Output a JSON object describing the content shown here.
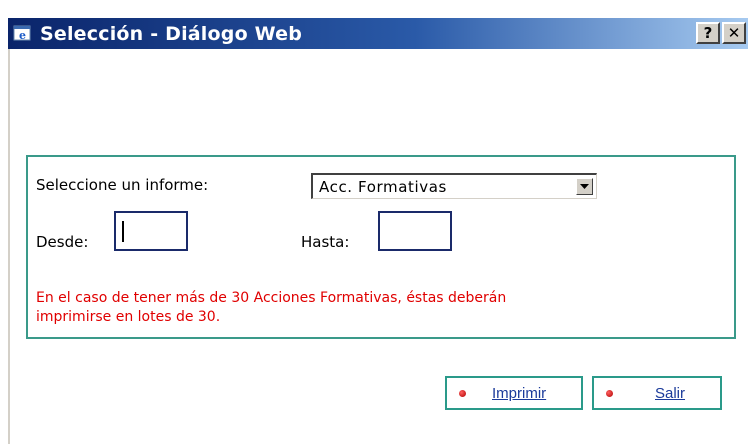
{
  "window": {
    "title": "Selección - Diálogo Web",
    "help_label": "?",
    "close_label": "✕"
  },
  "form": {
    "report_label": "Seleccione un informe:",
    "report_selected": "Acc. Formativas",
    "from_label": "Desde:",
    "from_value": "",
    "to_label": "Hasta:",
    "to_value": "",
    "note_line1": "En el caso de tener más de 30 Acciones Formativas, éstas deberán",
    "note_line2": "imprimirse en lotes de 30."
  },
  "buttons": {
    "print_label": "Imprimir",
    "exit_label": "Salir"
  },
  "colors": {
    "titlebar_start": "#0a246a",
    "titlebar_end": "#a6caf0",
    "panel_border": "#3a9a8a",
    "note_text": "#e00000",
    "button_text": "#1a3a9a"
  }
}
